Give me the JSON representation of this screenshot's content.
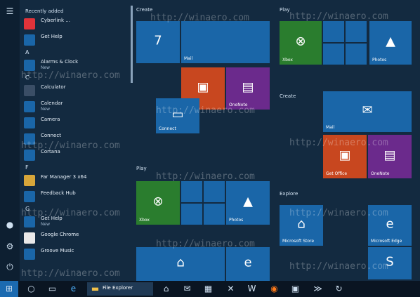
{
  "applist": {
    "recent_header": "Recently added",
    "groups": [
      {
        "letter": "",
        "items": [
          {
            "name": "Cyberlink ...",
            "sub": "",
            "color": "#e0333a"
          },
          {
            "name": "Get Help",
            "sub": "",
            "color": "#1a66a8"
          }
        ]
      },
      {
        "letter": "A",
        "items": [
          {
            "name": "Alarms & Clock",
            "sub": "New",
            "color": "#1a66a8"
          }
        ]
      },
      {
        "letter": "C",
        "items": [
          {
            "name": "Calculator",
            "sub": "",
            "color": "#3a4e66"
          },
          {
            "name": "Calendar",
            "sub": "New",
            "color": "#1a66a8"
          },
          {
            "name": "Camera",
            "sub": "",
            "color": "#1a66a8"
          },
          {
            "name": "Connect",
            "sub": "",
            "color": "#1a66a8"
          },
          {
            "name": "Cortana",
            "sub": "",
            "color": "#1a66a8"
          }
        ]
      },
      {
        "letter": "F",
        "items": [
          {
            "name": "Far Manager 3 x64",
            "sub": "",
            "color": "#d7a63a"
          },
          {
            "name": "Feedback Hub",
            "sub": "",
            "color": "#1a66a8"
          }
        ]
      },
      {
        "letter": "G",
        "items": [
          {
            "name": "Get Help",
            "sub": "New",
            "color": "#1a66a8"
          },
          {
            "name": "Google Chrome",
            "sub": "",
            "color": "#e9e9e9"
          },
          {
            "name": "Groove Music",
            "sub": "",
            "color": "#1a66a8"
          }
        ]
      }
    ]
  },
  "tiles": {
    "groups": [
      {
        "title": "Create"
      },
      {
        "title": "Play"
      },
      {
        "title": "Create"
      },
      {
        "title": "Play"
      },
      {
        "title": "Explore"
      },
      {
        "title": "Explore"
      }
    ],
    "items": [
      {
        "id": "calendar",
        "label": "",
        "glyph": "7",
        "color": "#1a66a8"
      },
      {
        "id": "mail",
        "label": "Mail",
        "glyph": "",
        "color": "#1a66a8"
      },
      {
        "id": "office",
        "label": "",
        "glyph": "▣",
        "color": "#c8471f"
      },
      {
        "id": "onenote-photo",
        "label": "OneNote",
        "glyph": "▤",
        "color": "#6b2a8c"
      },
      {
        "id": "connect",
        "label": "Connect",
        "glyph": "▭",
        "color": "#1a66a8"
      },
      {
        "id": "xbox",
        "label": "Xbox",
        "glyph": "⊗",
        "color": "#2a7d2e"
      },
      {
        "id": "photos-r",
        "label": "Photos",
        "glyph": "▲",
        "color": "#1a66a8"
      },
      {
        "id": "xbox2",
        "label": "Xbox",
        "glyph": "⊗",
        "color": "#2a7d2e"
      },
      {
        "id": "photos",
        "label": "Photos",
        "glyph": "▲",
        "color": "#1a66a8"
      },
      {
        "id": "mail2",
        "label": "Mail",
        "glyph": "✉",
        "color": "#1a66a8"
      },
      {
        "id": "office2",
        "label": "Get Office",
        "glyph": "▣",
        "color": "#c8471f"
      },
      {
        "id": "onenote",
        "label": "OneNote",
        "glyph": "▤",
        "color": "#6b2a8c"
      },
      {
        "id": "store",
        "label": "Microsoft Store",
        "glyph": "⌂",
        "color": "#1a66a8"
      },
      {
        "id": "edge",
        "label": "Microsoft Edge",
        "glyph": "e",
        "color": "#1a66a8"
      },
      {
        "id": "store2",
        "label": "",
        "glyph": "⌂",
        "color": "#1a66a8"
      },
      {
        "id": "edge2",
        "label": "",
        "glyph": "e",
        "color": "#1a66a8"
      },
      {
        "id": "skype",
        "label": "",
        "glyph": "S",
        "color": "#1a66a8"
      }
    ]
  },
  "taskbar": {
    "file_explorer_label": "File Explorer"
  },
  "watermark": "http://winaero.com"
}
